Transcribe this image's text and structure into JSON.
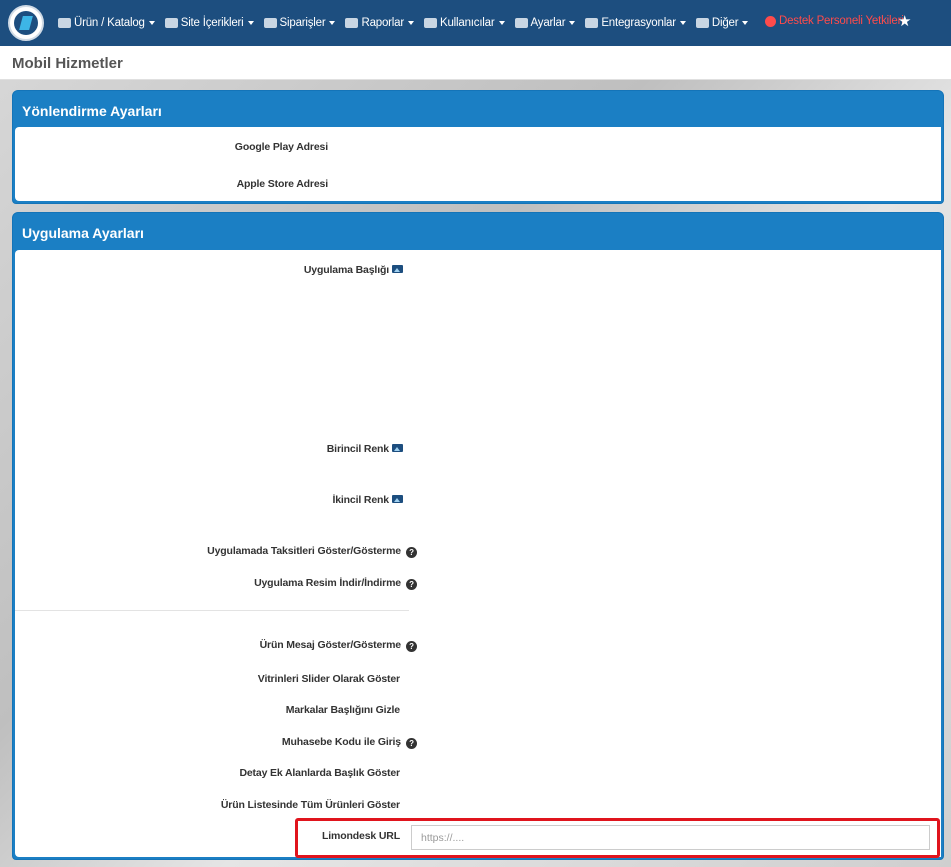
{
  "navbar": {
    "logo_alt": "AKINSOFT",
    "items": [
      {
        "label": "Ürün / Katalog",
        "icon": "cubes-icon"
      },
      {
        "label": "Site İçerikleri",
        "icon": "files-icon"
      },
      {
        "label": "Siparişler",
        "icon": "truck-icon"
      },
      {
        "label": "Raporlar",
        "icon": "report-icon"
      },
      {
        "label": "Kullanıcılar",
        "icon": "users-icon"
      },
      {
        "label": "Ayarlar",
        "icon": "cogs-icon"
      },
      {
        "label": "Entegrasyonlar",
        "icon": "sitemap-icon"
      },
      {
        "label": "Diğer",
        "icon": "calendar-icon"
      }
    ],
    "support_label": "Destek Personeli Yetkileri",
    "colors": {
      "bar": "#1d4e7f",
      "support": "#ff4b4b"
    }
  },
  "page": {
    "title": "Mobil Hizmetler"
  },
  "redirect_panel": {
    "title": "Yönlendirme Ayarları",
    "google_play_label": "Google Play Adresi",
    "apple_store_label": "Apple Store Adresi"
  },
  "app_panel": {
    "title": "Uygulama Ayarları",
    "app_title_label": "Uygulama Başlığı",
    "primary_color_label": "Birincil Renk",
    "secondary_color_label": "İkincil Renk",
    "installments_label": "Uygulamada Taksitleri Göster/Gösterme",
    "image_download_label": "Uygulama Resim İndir/İndirme",
    "product_message_label": "Ürün Mesaj Göster/Gösterme",
    "slider_label": "Vitrinleri Slider Olarak Göster",
    "brands_title_label": "Markalar Başlığını Gizle",
    "accounting_code_label": "Muhasebe Kodu ile Giriş",
    "detail_fields_label": "Detay Ek Alanlarda Başlık Göster",
    "all_products_label": "Ürün Listesinde Tüm Ürünleri Göster",
    "limondesk_label": "Limondesk URL",
    "limondesk_placeholder": "https://....",
    "limondesk_value": ""
  },
  "colors": {
    "panel": "#1b7fc4",
    "highlight": "#e0141d"
  }
}
